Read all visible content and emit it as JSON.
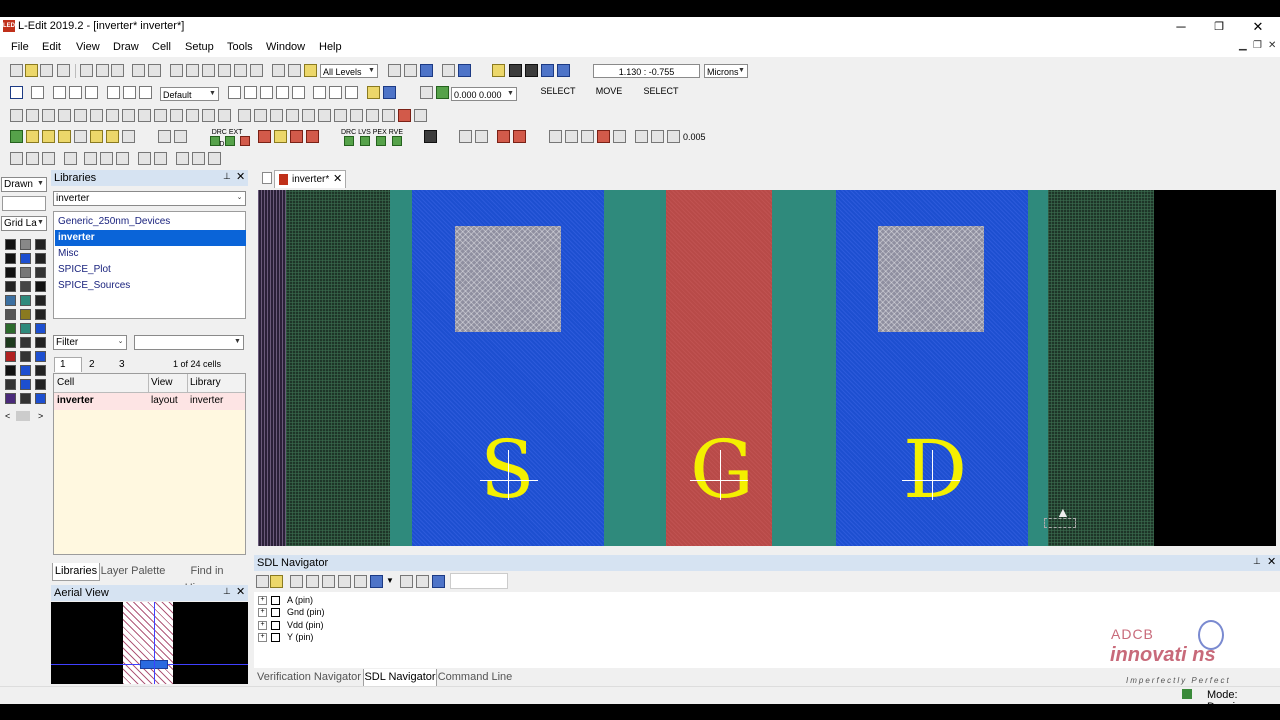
{
  "window": {
    "title": "L-Edit 2019.2 - [inverter*     inverter*]",
    "minimize": "─",
    "maximize": "❐",
    "close": "✕",
    "mdi_minimize": "▁",
    "mdi_restore": "❐",
    "mdi_close": "✕"
  },
  "menu": [
    "File",
    "Edit",
    "View",
    "Draw",
    "Cell",
    "Setup",
    "Tools",
    "Window",
    "Help"
  ],
  "toolbar": {
    "levels_select": "All Levels",
    "coords": "1.130 : -0.755",
    "units_select": "Microns",
    "style_select": "Default",
    "offset_value": "0.000 0.000",
    "mouse_left": "SELECT",
    "mouse_middle": "MOVE",
    "mouse_right": "SELECT",
    "snap_value": "0.005",
    "run_labels": [
      "DRC",
      "EXT",
      "DRC"
    ],
    "verify_labels": [
      "DRC",
      "LVS",
      "PEX",
      "RVE"
    ]
  },
  "left_strip": {
    "drawn_select": "Drawn",
    "grid_select": "Grid La"
  },
  "libraries_panel": {
    "title": "Libraries",
    "pin_icon": "📌",
    "close_icon": "✕",
    "library_select": "inverter",
    "items": [
      "Generic_250nm_Devices",
      "inverter",
      "Misc",
      "SPICE_Plot",
      "SPICE_Sources"
    ],
    "selected_item": "inverter",
    "filter_label": "Filter",
    "filter_value": "",
    "page_tabs": [
      "1",
      "2",
      "3"
    ],
    "cell_count": "1 of 24 cells",
    "columns": [
      "Cell",
      "View",
      "Library"
    ],
    "rows": [
      {
        "cell": "inverter",
        "view": "layout",
        "library": "inverter"
      }
    ],
    "bottom_tabs": [
      "Libraries",
      "Layer Palette",
      "Find in Hierarc..."
    ]
  },
  "aerial_view": {
    "title": "Aerial View"
  },
  "document": {
    "tab_label": "inverter*",
    "tab_close": "✕",
    "pins": [
      "S",
      "G",
      "D"
    ],
    "colors": {
      "metal": "#1d4fd0",
      "poly": "#b84a48",
      "active": "#2f8a7c",
      "well": "#243c30",
      "contact": "#8f8fa0",
      "text": "#f4f000"
    }
  },
  "sdl_navigator": {
    "title": "SDL Navigator",
    "items": [
      "A (pin)",
      "Gnd (pin)",
      "Vdd (pin)",
      "Y (pin)"
    ],
    "bottom_tabs": [
      "Verification Navigator",
      "SDL Navigator",
      "Command Line"
    ],
    "active_tab": "SDL Navigator"
  },
  "watermark": {
    "brand": "ADCB",
    "name": "innovati  ns",
    "tagline": "Imperfectly Perfect"
  },
  "status": {
    "mode": "Mode: Drawing"
  }
}
